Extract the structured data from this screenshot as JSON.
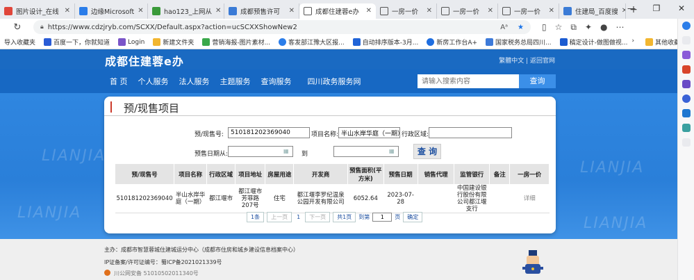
{
  "browser": {
    "tabs": [
      {
        "title": "图片设计_在线",
        "color": "#e0463a"
      },
      {
        "title": "边缘Microsoft",
        "color": "#2b7de9"
      },
      {
        "title": "hao123_上网从",
        "color": "#3a9a3a"
      },
      {
        "title": "成都预售许可",
        "color": "#3b7bd6"
      },
      {
        "title": "成都住建蓉e办",
        "color": "#ffffff",
        "active": true
      },
      {
        "title": "一房一价",
        "color": "#ffffff"
      },
      {
        "title": "一房一价",
        "color": "#ffffff"
      },
      {
        "title": "一房一价",
        "color": "#ffffff"
      },
      {
        "title": "住建局_百度搜",
        "color": "#3b7bd6"
      }
    ],
    "url": "https://www.cdzjryb.com/SCXX/Default.aspx?action=ucSCXXShowNew2",
    "bookmarks": [
      {
        "label": "导入收藏夹",
        "color": "#f0f0f0"
      },
      {
        "label": "百度一下，你就知道",
        "color": "#2a5cd6"
      },
      {
        "label": "Login",
        "color": "#7a55c8"
      },
      {
        "label": "新建文件夹",
        "color": "#f2b630"
      },
      {
        "label": "营销海报-图片素材...",
        "color": "#3aa84a"
      },
      {
        "label": "客发部江豫大区报...",
        "color": "#2b7de9"
      },
      {
        "label": "自动排序版本-3月...",
        "color": "#2164d8"
      },
      {
        "label": "新房工作台A+",
        "color": "#1f6ee0"
      },
      {
        "label": "国家税务总局四川...",
        "color": "#3d7ad9"
      },
      {
        "label": "稿定设计-做图做视...",
        "color": "#1b5bd1"
      }
    ],
    "other_bookmarks": "其他收藏夹"
  },
  "site": {
    "brand": "成都住建蓉e办",
    "top_links": "繁體中文 | 返回官网",
    "nav": [
      "首 页",
      "个人服务",
      "法人服务",
      "主题服务",
      "查询服务",
      "四川政务服务网"
    ],
    "search_placeholder": "请输入搜索内容",
    "search_button": "查询"
  },
  "form": {
    "title": "预/现售项目",
    "label_permit": "预/现售号:",
    "value_permit": "510181202369040",
    "label_project": "项目名称:",
    "value_project": "半山水岸华庭（一期）",
    "label_area": "行政区域:",
    "value_area": "",
    "label_date_from": "预售日期从:",
    "label_to": "到",
    "query_button": "查 询"
  },
  "table": {
    "headers": [
      "预/现售号",
      "项目名称",
      "行政区域",
      "项目地址",
      "房屋用途",
      "开发商",
      "预售面积(平方米)",
      "预售日期",
      "销售代理",
      "监管银行",
      "备注",
      "一房一价"
    ],
    "rows": [
      [
        "510181202369040",
        "半山水岸华庭（一期）",
        "都江堰市",
        "都江堰市芳菲路207号",
        "住宅",
        "都江堰李罗纪温泉公园开发有限公司",
        "6052.64",
        "2023-07-28",
        "",
        "中国建设银行股份有限公司都江堰支行",
        "",
        "详细"
      ]
    ]
  },
  "pager": {
    "count": "1条",
    "prev": "上一页",
    "current": "1",
    "next": "下一页",
    "total": "共1页",
    "goto_label": "到第",
    "goto_value": "1",
    "page_unit": "页",
    "confirm": "确定"
  },
  "footer": {
    "host": "主办：成都市智慧蓉城住建城运分中心（成都市住房和城乡建设信息档案中心）",
    "icp": "IP证备案/许可证编号：蜀ICP备2021021339号",
    "police": "川公网安备 51010502011340号"
  }
}
